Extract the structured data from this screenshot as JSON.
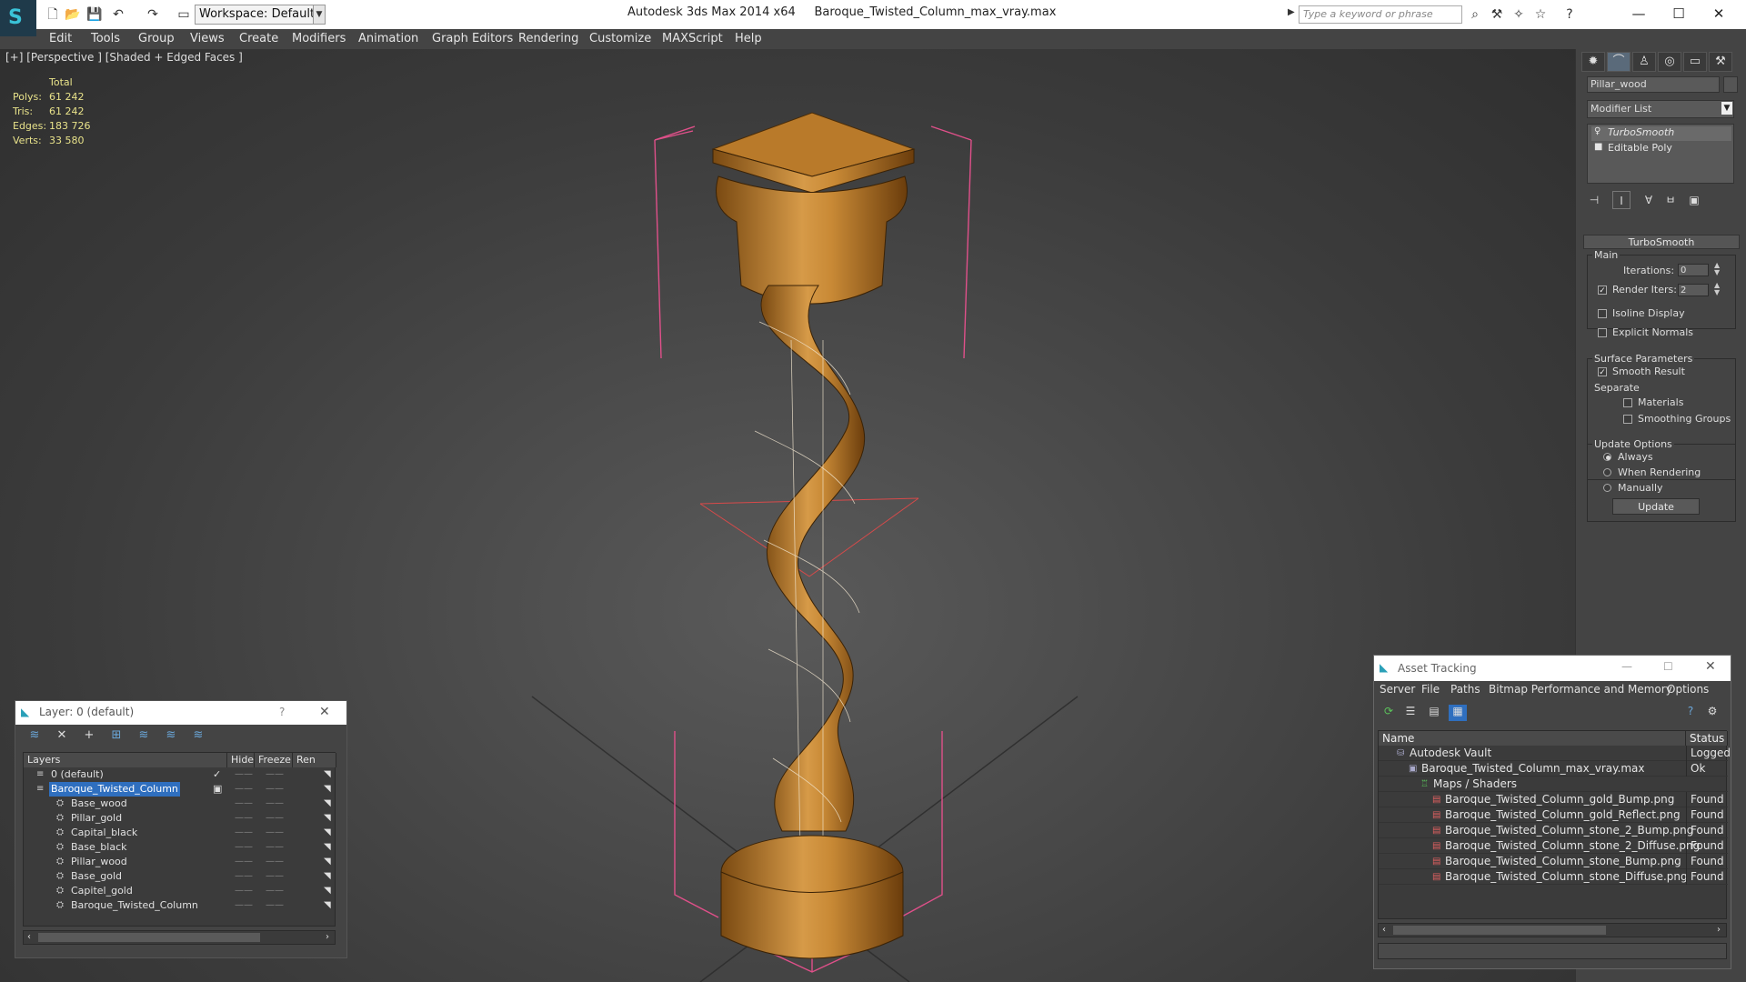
{
  "title_bar": {
    "workspace_label": "Workspace: Default",
    "app_title": "Autodesk 3ds Max  2014 x64",
    "file_name": "Baroque_Twisted_Column_max_vray.max",
    "search_placeholder": "Type a keyword or phrase"
  },
  "menu": [
    "Edit",
    "Tools",
    "Group",
    "Views",
    "Create",
    "Modifiers",
    "Animation",
    "Graph Editors",
    "Rendering",
    "Customize",
    "MAXScript",
    "Help"
  ],
  "viewport": {
    "label": "[+] [Perspective ] [Shaded + Edged Faces ]",
    "stats_header": "Total",
    "stats": [
      {
        "label": "Polys:",
        "value": "61 242"
      },
      {
        "label": "Tris:",
        "value": "61 242"
      },
      {
        "label": "Edges:",
        "value": "183 726"
      },
      {
        "label": "Verts:",
        "value": "33 580"
      }
    ]
  },
  "command_panel": {
    "object_name": "Pillar_wood",
    "modifier_list": "Modifier List",
    "stack": [
      "TurboSmooth",
      "Editable Poly"
    ],
    "rollout_title": "TurboSmooth",
    "main_group": "Main",
    "iterations_label": "Iterations:",
    "iterations_value": "0",
    "render_iters_label": "Render Iters:",
    "render_iters_value": "2",
    "isoline_label": "Isoline Display",
    "explicit_label": "Explicit Normals",
    "surface_group": "Surface Parameters",
    "smooth_result_label": "Smooth Result",
    "separate_label": "Separate",
    "materials_label": "Materials",
    "smoothing_label": "Smoothing Groups",
    "update_group": "Update Options",
    "always_label": "Always",
    "when_rendering_label": "When Rendering",
    "manually_label": "Manually",
    "update_button": "Update"
  },
  "layer_dialog": {
    "title": "Layer: 0 (default)",
    "help": "?",
    "columns": [
      "Layers",
      "Hide",
      "Freeze",
      "Ren"
    ],
    "layers": [
      {
        "name": "0 (default)",
        "level": 0
      },
      {
        "name": "Baroque_Twisted_Column",
        "level": 0
      },
      {
        "name": "Base_wood",
        "level": 1
      },
      {
        "name": "Pillar_gold",
        "level": 1
      },
      {
        "name": "Capital_black",
        "level": 1
      },
      {
        "name": "Base_black",
        "level": 1
      },
      {
        "name": "Pillar_wood",
        "level": 1
      },
      {
        "name": "Base_gold",
        "level": 1
      },
      {
        "name": "Capitel_gold",
        "level": 1
      },
      {
        "name": "Baroque_Twisted_Column",
        "level": 1
      }
    ]
  },
  "asset_tracking": {
    "title": "Asset Tracking",
    "menu": [
      "Server",
      "File",
      "Paths",
      "Bitmap Performance and Memory",
      "Options"
    ],
    "columns": [
      "Name",
      "Status"
    ],
    "rows": [
      {
        "name": "Autodesk Vault",
        "status": "Logged",
        "level": 0
      },
      {
        "name": "Baroque_Twisted_Column_max_vray.max",
        "status": "Ok",
        "level": 1
      },
      {
        "name": "Maps / Shaders",
        "status": "",
        "level": 2
      },
      {
        "name": "Baroque_Twisted_Column_gold_Bump.png",
        "status": "Found",
        "level": 3
      },
      {
        "name": "Baroque_Twisted_Column_gold_Reflect.png",
        "status": "Found",
        "level": 3
      },
      {
        "name": "Baroque_Twisted_Column_stone_2_Bump.png",
        "status": "Found",
        "level": 3
      },
      {
        "name": "Baroque_Twisted_Column_stone_2_Diffuse.png",
        "status": "Found",
        "level": 3
      },
      {
        "name": "Baroque_Twisted_Column_stone_Bump.png",
        "status": "Found",
        "level": 3
      },
      {
        "name": "Baroque_Twisted_Column_stone_Diffuse.png",
        "status": "Found",
        "level": 3
      }
    ]
  },
  "colors": {
    "selection": "#2f6fbf",
    "column_wood": "#c8852f",
    "bounding_box": "#e0508a",
    "stats_text": "#e8e28a"
  }
}
